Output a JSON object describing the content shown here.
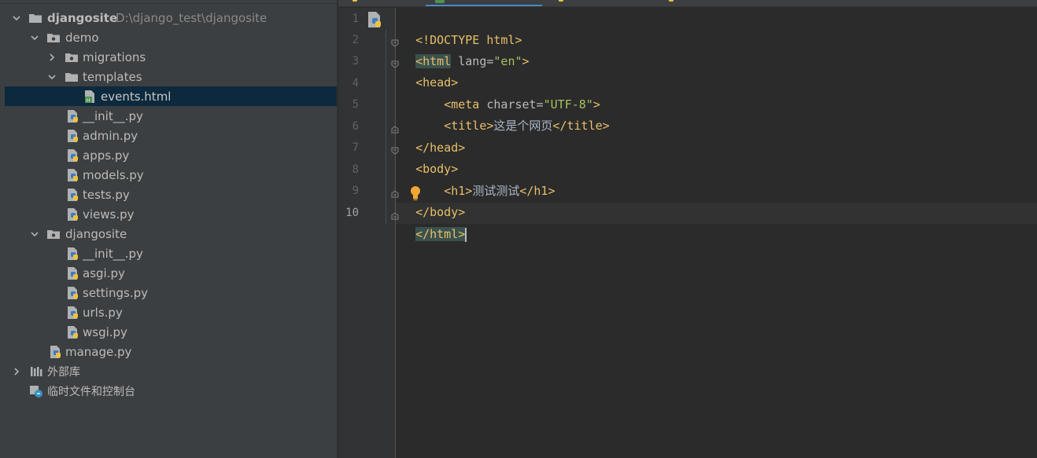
{
  "project_tree": {
    "root": {
      "name": "djangosite",
      "path": "D:\\django_test\\djangosite"
    },
    "items": [
      {
        "label": "demo"
      },
      {
        "label": "migrations"
      },
      {
        "label": "templates"
      },
      {
        "label": "events.html"
      },
      {
        "label": "__init__.py"
      },
      {
        "label": "admin.py"
      },
      {
        "label": "apps.py"
      },
      {
        "label": "models.py"
      },
      {
        "label": "tests.py"
      },
      {
        "label": "views.py"
      },
      {
        "label": "djangosite"
      },
      {
        "label": "__init__.py"
      },
      {
        "label": "asgi.py"
      },
      {
        "label": "settings.py"
      },
      {
        "label": "urls.py"
      },
      {
        "label": "wsgi.py"
      },
      {
        "label": "manage.py"
      },
      {
        "label": "外部库"
      },
      {
        "label": "临时文件和控制台"
      }
    ]
  },
  "editor": {
    "line_numbers": [
      "1",
      "2",
      "3",
      "4",
      "5",
      "6",
      "7",
      "8",
      "9",
      "10"
    ],
    "code": {
      "l1": {
        "tag": "<!DOCTYPE html>"
      },
      "l2": {
        "open": "<html",
        "attr": " lang=",
        "val": "\"en\"",
        "close": ">"
      },
      "l3": {
        "tag": "<head>"
      },
      "l4": {
        "indent": "    ",
        "open": "<meta",
        "attr": " charset=",
        "val": "\"UTF-8\"",
        "close": ">"
      },
      "l5": {
        "indent": "    ",
        "open": "<title>",
        "text": "这是个网页",
        "close": "</title>"
      },
      "l6": {
        "tag": "</head>"
      },
      "l7": {
        "tag": "<body>"
      },
      "l8": {
        "indent": "    ",
        "open": "<h1>",
        "text": "测试测试",
        "close": "</h1>"
      },
      "l9": {
        "tag": "</body>"
      },
      "l10": {
        "tag": "</html>"
      }
    }
  },
  "colors": {
    "panel_bg": "#3c3f41",
    "editor_bg": "#2b2b2b",
    "selection": "#0d293e",
    "tag": "#e8bf6a",
    "attr_value": "#a5c25c",
    "active_tab": "#4a88c7"
  },
  "icons": {
    "folder": "folder-icon",
    "python_file": "python-file-icon",
    "html_file": "html-file-icon",
    "libraries": "library-icon",
    "scratches": "scratches-icon",
    "intention": "lightbulb-icon"
  }
}
